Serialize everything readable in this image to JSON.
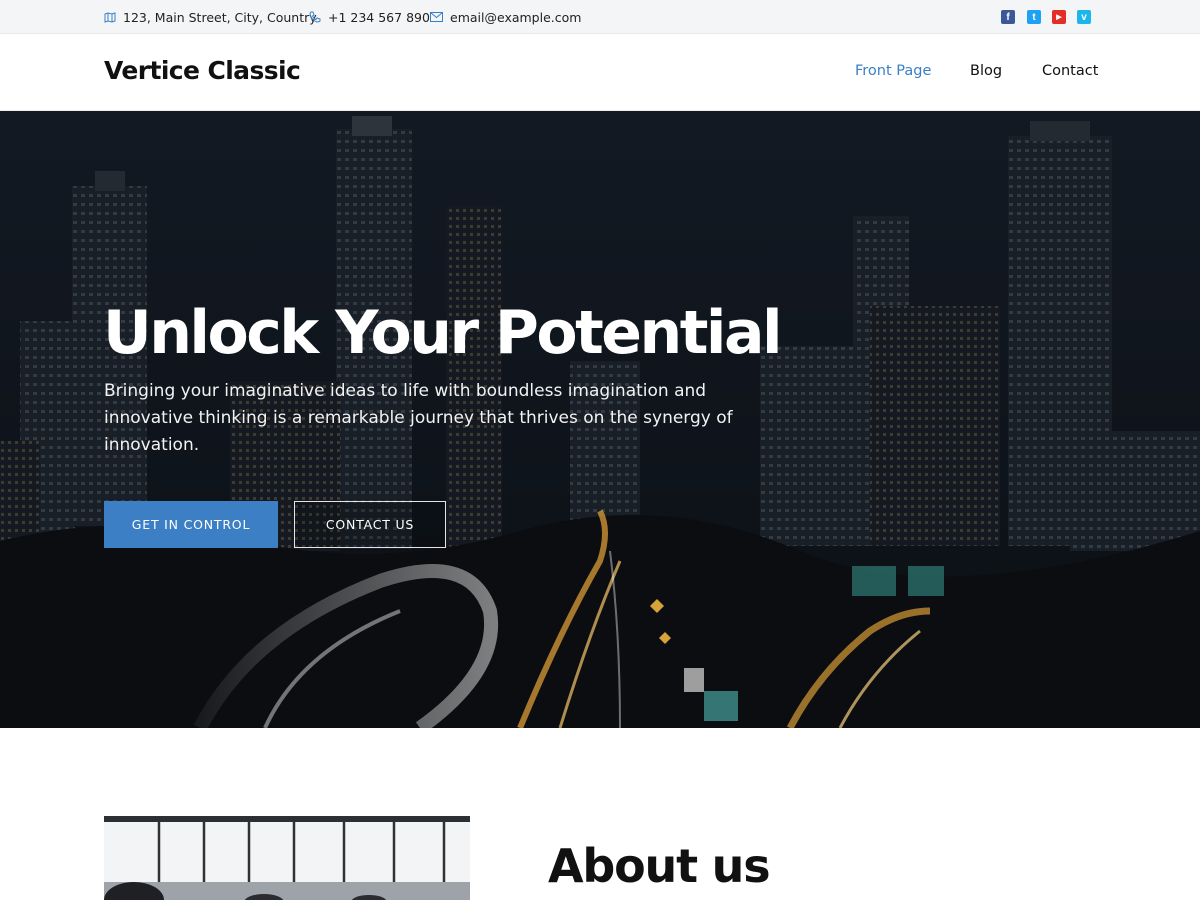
{
  "topbar": {
    "address": "123, Main Street, City, Country",
    "phone": "+1 234 567 890",
    "email": "email@example.com",
    "social": [
      {
        "name": "facebook",
        "glyph": "f",
        "color": "#3b5998"
      },
      {
        "name": "twitter",
        "glyph": "t",
        "color": "#1da1f2"
      },
      {
        "name": "youtube",
        "glyph": "▶",
        "color": "#e52d27"
      },
      {
        "name": "vimeo",
        "glyph": "v",
        "color": "#1ab7ea"
      }
    ]
  },
  "header": {
    "logo": "Vertice Classic",
    "nav": [
      {
        "label": "Front Page",
        "active": true
      },
      {
        "label": "Blog",
        "active": false
      },
      {
        "label": "Contact",
        "active": false
      }
    ]
  },
  "hero": {
    "title": "Unlock Your Potential",
    "subtitle": "Bringing your imaginative ideas to life with boundless imagination and innovative thinking is a remarkable journey that thrives on the synergy of innovation.",
    "primary_button": "GET IN CONTROL",
    "secondary_button": "CONTACT US",
    "background": "night city skyline with light-trail highways"
  },
  "about": {
    "title": "About us"
  },
  "colors": {
    "accent": "#3d7fc4",
    "topbar_bg": "#f4f5f7",
    "text": "#111111"
  }
}
